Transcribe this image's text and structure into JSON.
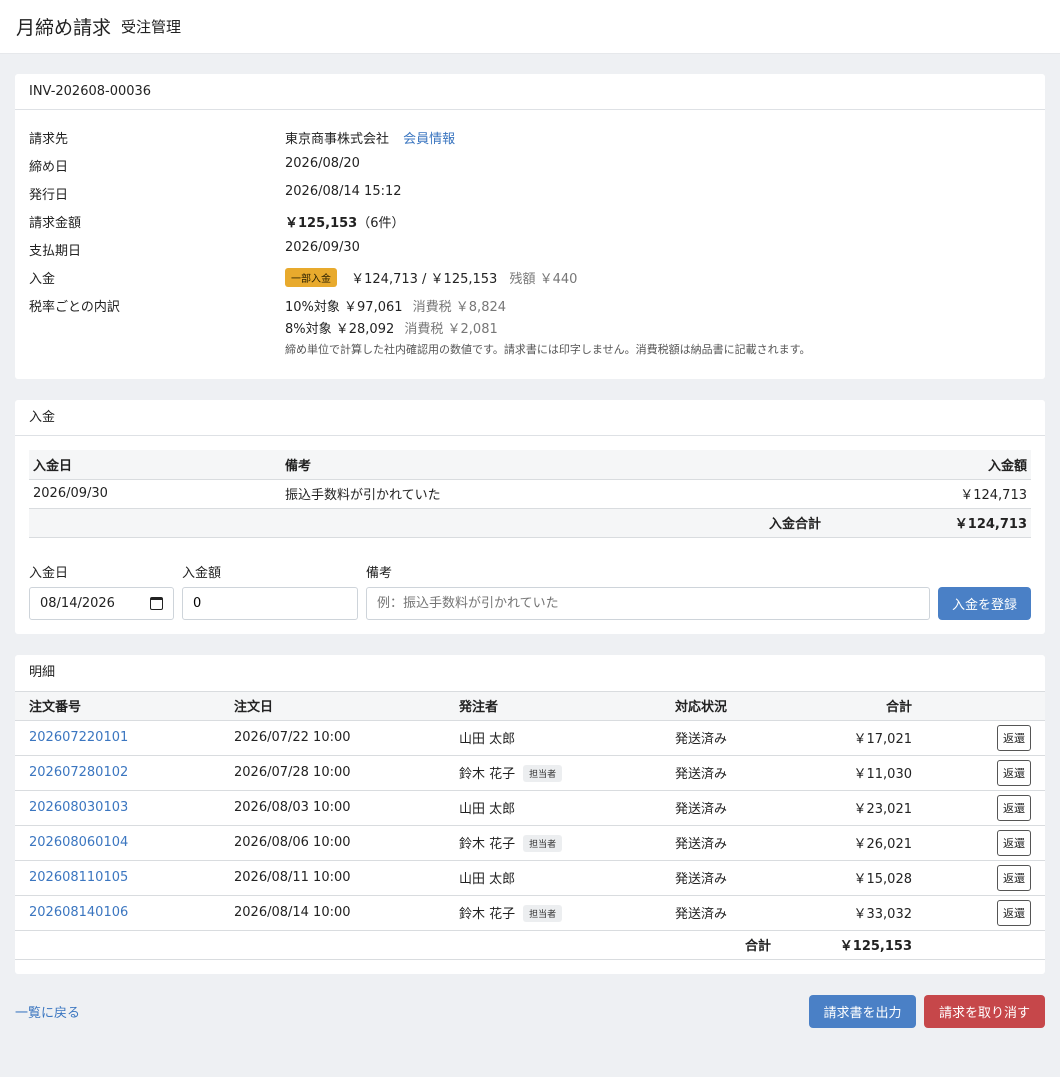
{
  "header": {
    "title": "月締め請求",
    "subtitle": "受注管理"
  },
  "invoice": {
    "number": "INV-202608-00036",
    "rows": {
      "billing_to_label": "請求先",
      "billing_to_value": "東京商事株式会社",
      "member_link": "会員情報",
      "closing_label": "締め日",
      "closing_value": "2026/08/20",
      "issue_label": "発行日",
      "issue_value": "2026/08/14 15:12",
      "amount_label": "請求金額",
      "amount_value": "￥125,153",
      "amount_count": "（6件）",
      "due_label": "支払期日",
      "due_value": "2026/09/30",
      "payment_label": "入金",
      "payment_badge": "一部入金",
      "payment_value": "￥124,713 / ￥125,153",
      "payment_balance": "残額 ￥440",
      "tax_label": "税率ごとの内訳",
      "tax10_target": "10%対象 ￥97,061",
      "tax10_tax": "消費税 ￥8,824",
      "tax8_target": "8%対象 ￥28,092",
      "tax8_tax": "消費税 ￥2,081",
      "tax_note": "締め単位で計算した社内確認用の数値です。請求書には印字しません。消費税額は納品書に記載されます。"
    }
  },
  "payments": {
    "title": "入金",
    "headers": {
      "date": "入金日",
      "note": "備考",
      "amount": "入金額"
    },
    "rows": [
      {
        "date": "2026/09/30",
        "note": "振込手数料が引かれていた",
        "amount": "￥124,713"
      }
    ],
    "total_label": "入金合計",
    "total_value": "￥124,713",
    "form": {
      "date_label": "入金日",
      "date_value": "08/14/2026",
      "amount_label": "入金額",
      "amount_value": "0",
      "note_label": "備考",
      "note_placeholder": "例：振込手数料が引かれていた",
      "submit_label": "入金を登録"
    }
  },
  "details": {
    "title": "明細",
    "headers": {
      "order_no": "注文番号",
      "order_date": "注文日",
      "orderer": "発注者",
      "status": "対応状況",
      "total": "合計"
    },
    "rows": [
      {
        "order_no": "202607220101",
        "order_date": "2026/07/22 10:00",
        "orderer": "山田 太郎",
        "tag": "",
        "status": "発送済み",
        "total": "￥17,021",
        "action": "返還"
      },
      {
        "order_no": "202607280102",
        "order_date": "2026/07/28 10:00",
        "orderer": "鈴木 花子",
        "tag": "担当者",
        "status": "発送済み",
        "total": "￥11,030",
        "action": "返還"
      },
      {
        "order_no": "202608030103",
        "order_date": "2026/08/03 10:00",
        "orderer": "山田 太郎",
        "tag": "",
        "status": "発送済み",
        "total": "￥23,021",
        "action": "返還"
      },
      {
        "order_no": "202608060104",
        "order_date": "2026/08/06 10:00",
        "orderer": "鈴木 花子",
        "tag": "担当者",
        "status": "発送済み",
        "total": "￥26,021",
        "action": "返還"
      },
      {
        "order_no": "202608110105",
        "order_date": "2026/08/11 10:00",
        "orderer": "山田 太郎",
        "tag": "",
        "status": "発送済み",
        "total": "￥15,028",
        "action": "返還"
      },
      {
        "order_no": "202608140106",
        "order_date": "2026/08/14 10:00",
        "orderer": "鈴木 花子",
        "tag": "担当者",
        "status": "発送済み",
        "total": "￥33,032",
        "action": "返還"
      }
    ],
    "total_label": "合計",
    "total_value": "￥125,153"
  },
  "footer": {
    "back_link": "一覧に戻る",
    "export_button": "請求書を出力",
    "cancel_button": "請求を取り消す"
  },
  "colors": {
    "primary": "#4a80c6",
    "danger": "#c6474a",
    "link": "#3b76c0",
    "badge": "#e8aa2d"
  }
}
